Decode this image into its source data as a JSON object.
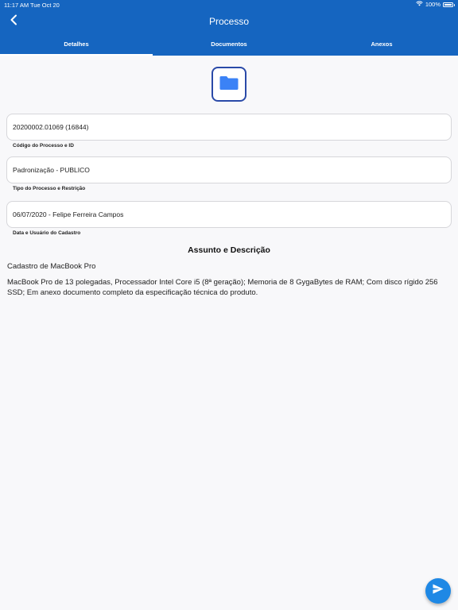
{
  "status_bar": {
    "time": "11:17 AM",
    "date": "Tue Oct 20",
    "battery": "100%",
    "battery_level": 1.0
  },
  "header": {
    "title": "Processo",
    "back_icon": "chevron-left-icon"
  },
  "tabs": [
    {
      "label": "Detalhes",
      "active": true
    },
    {
      "label": "Documentos",
      "active": false
    },
    {
      "label": "Anexos",
      "active": false
    }
  ],
  "folder_icon": "folder-icon",
  "fields": [
    {
      "value": "20200002.01069 (16844)",
      "label": "Código do Processo e ID"
    },
    {
      "value": "Padronização - PUBLICO",
      "label": "Tipo do Processo e Restrição"
    },
    {
      "value": "06/07/2020 - Felipe Ferreira Campos",
      "label": "Data e Usuário do Cadastro"
    }
  ],
  "section": {
    "title": "Assunto e Descrição",
    "subject": "Cadastro de MacBook Pro",
    "description": "MacBook Pro de 13 polegadas, Processador Intel Core i5 (8ª geração); Memoria de 8 GygaBytes de RAM; Com disco rígido 256 SSD; Em anexo documento completo da especificação técnica do produto."
  },
  "fab": {
    "icon": "send-icon"
  },
  "colors": {
    "primary": "#1565c0",
    "accent": "#1e88e5",
    "folder": "#3b82f6",
    "folder_border": "#2a4aa8"
  }
}
